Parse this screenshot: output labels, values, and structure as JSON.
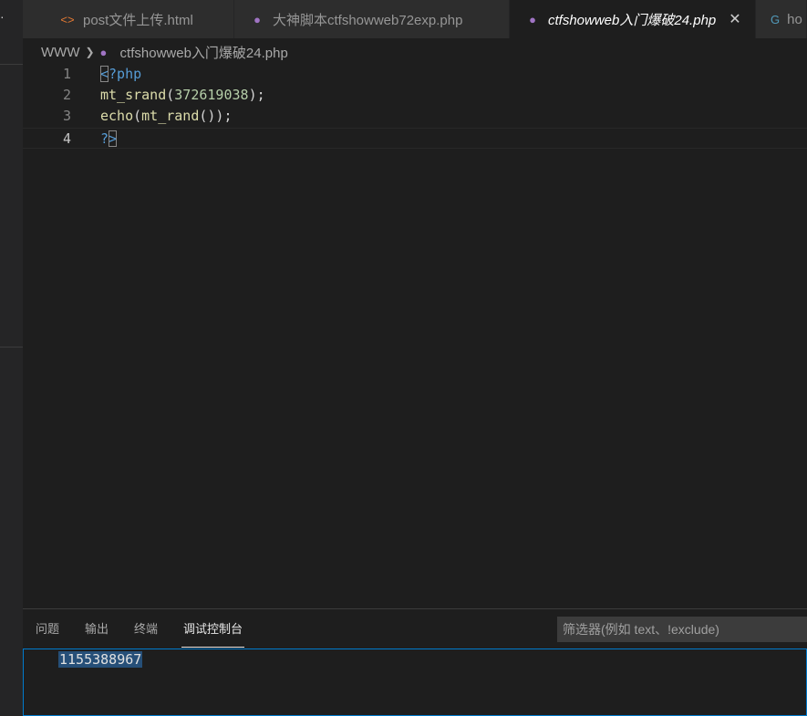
{
  "tabs": [
    {
      "label": "post文件上传.html",
      "icon": "html-icon",
      "active": false
    },
    {
      "label": "大神脚本ctfshowweb72exp.php",
      "icon": "php-icon",
      "active": false
    },
    {
      "label": "ctfshowweb入门爆破24.php",
      "icon": "php-icon",
      "active": true
    },
    {
      "label": "ho",
      "icon": "cpp-icon",
      "active": false
    }
  ],
  "breadcrumb": {
    "folder": "WWW",
    "file": "ctfshowweb入门爆破24.php"
  },
  "editor": {
    "lines": [
      {
        "number": "1",
        "parts": {
          "open": "<",
          "rest": "?php"
        }
      },
      {
        "number": "2",
        "parts": {
          "fn": "mt_srand",
          "lp": "(",
          "num": "372619038",
          "rp": ");"
        }
      },
      {
        "number": "3",
        "parts": {
          "fn1": "echo",
          "lp1": "(",
          "fn2": "mt_rand",
          "rest": "());"
        }
      },
      {
        "number": "4",
        "parts": {
          "q": "?",
          "close": ">"
        }
      }
    ]
  },
  "panel": {
    "tabs": [
      "问题",
      "输出",
      "终端",
      "调试控制台"
    ],
    "active_tab": "调试控制台",
    "filter_placeholder": "筛选器(例如 text、!exclude)",
    "output": "1155388967"
  },
  "colors": {
    "accent": "#007acc",
    "selection": "#264f78",
    "php_icon": "#a074c4",
    "html_icon": "#e37933"
  }
}
